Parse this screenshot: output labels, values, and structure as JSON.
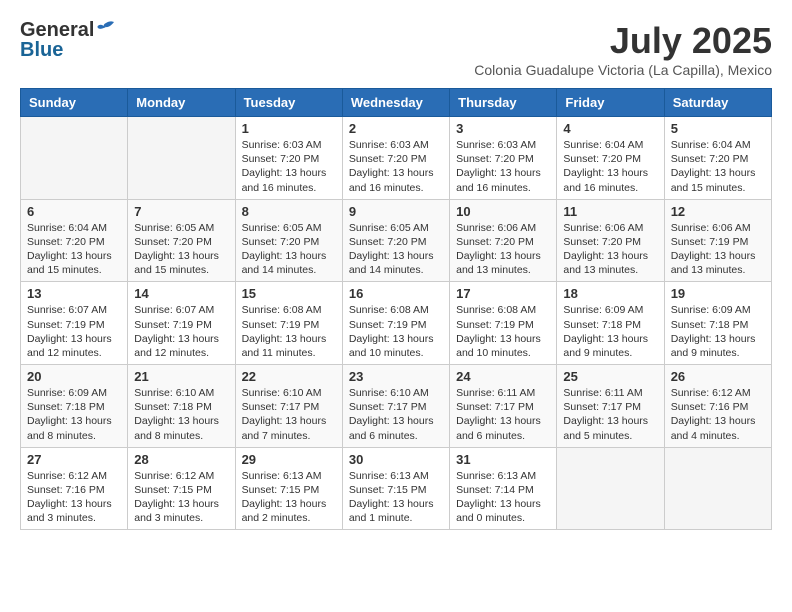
{
  "header": {
    "logo_general": "General",
    "logo_blue": "Blue",
    "month": "July 2025",
    "location": "Colonia Guadalupe Victoria (La Capilla), Mexico"
  },
  "weekdays": [
    "Sunday",
    "Monday",
    "Tuesday",
    "Wednesday",
    "Thursday",
    "Friday",
    "Saturday"
  ],
  "weeks": [
    [
      {
        "day": "",
        "info": ""
      },
      {
        "day": "",
        "info": ""
      },
      {
        "day": "1",
        "info": "Sunrise: 6:03 AM\nSunset: 7:20 PM\nDaylight: 13 hours\nand 16 minutes."
      },
      {
        "day": "2",
        "info": "Sunrise: 6:03 AM\nSunset: 7:20 PM\nDaylight: 13 hours\nand 16 minutes."
      },
      {
        "day": "3",
        "info": "Sunrise: 6:03 AM\nSunset: 7:20 PM\nDaylight: 13 hours\nand 16 minutes."
      },
      {
        "day": "4",
        "info": "Sunrise: 6:04 AM\nSunset: 7:20 PM\nDaylight: 13 hours\nand 16 minutes."
      },
      {
        "day": "5",
        "info": "Sunrise: 6:04 AM\nSunset: 7:20 PM\nDaylight: 13 hours\nand 15 minutes."
      }
    ],
    [
      {
        "day": "6",
        "info": "Sunrise: 6:04 AM\nSunset: 7:20 PM\nDaylight: 13 hours\nand 15 minutes."
      },
      {
        "day": "7",
        "info": "Sunrise: 6:05 AM\nSunset: 7:20 PM\nDaylight: 13 hours\nand 15 minutes."
      },
      {
        "day": "8",
        "info": "Sunrise: 6:05 AM\nSunset: 7:20 PM\nDaylight: 13 hours\nand 14 minutes."
      },
      {
        "day": "9",
        "info": "Sunrise: 6:05 AM\nSunset: 7:20 PM\nDaylight: 13 hours\nand 14 minutes."
      },
      {
        "day": "10",
        "info": "Sunrise: 6:06 AM\nSunset: 7:20 PM\nDaylight: 13 hours\nand 13 minutes."
      },
      {
        "day": "11",
        "info": "Sunrise: 6:06 AM\nSunset: 7:20 PM\nDaylight: 13 hours\nand 13 minutes."
      },
      {
        "day": "12",
        "info": "Sunrise: 6:06 AM\nSunset: 7:19 PM\nDaylight: 13 hours\nand 13 minutes."
      }
    ],
    [
      {
        "day": "13",
        "info": "Sunrise: 6:07 AM\nSunset: 7:19 PM\nDaylight: 13 hours\nand 12 minutes."
      },
      {
        "day": "14",
        "info": "Sunrise: 6:07 AM\nSunset: 7:19 PM\nDaylight: 13 hours\nand 12 minutes."
      },
      {
        "day": "15",
        "info": "Sunrise: 6:08 AM\nSunset: 7:19 PM\nDaylight: 13 hours\nand 11 minutes."
      },
      {
        "day": "16",
        "info": "Sunrise: 6:08 AM\nSunset: 7:19 PM\nDaylight: 13 hours\nand 10 minutes."
      },
      {
        "day": "17",
        "info": "Sunrise: 6:08 AM\nSunset: 7:19 PM\nDaylight: 13 hours\nand 10 minutes."
      },
      {
        "day": "18",
        "info": "Sunrise: 6:09 AM\nSunset: 7:18 PM\nDaylight: 13 hours\nand 9 minutes."
      },
      {
        "day": "19",
        "info": "Sunrise: 6:09 AM\nSunset: 7:18 PM\nDaylight: 13 hours\nand 9 minutes."
      }
    ],
    [
      {
        "day": "20",
        "info": "Sunrise: 6:09 AM\nSunset: 7:18 PM\nDaylight: 13 hours\nand 8 minutes."
      },
      {
        "day": "21",
        "info": "Sunrise: 6:10 AM\nSunset: 7:18 PM\nDaylight: 13 hours\nand 8 minutes."
      },
      {
        "day": "22",
        "info": "Sunrise: 6:10 AM\nSunset: 7:17 PM\nDaylight: 13 hours\nand 7 minutes."
      },
      {
        "day": "23",
        "info": "Sunrise: 6:10 AM\nSunset: 7:17 PM\nDaylight: 13 hours\nand 6 minutes."
      },
      {
        "day": "24",
        "info": "Sunrise: 6:11 AM\nSunset: 7:17 PM\nDaylight: 13 hours\nand 6 minutes."
      },
      {
        "day": "25",
        "info": "Sunrise: 6:11 AM\nSunset: 7:17 PM\nDaylight: 13 hours\nand 5 minutes."
      },
      {
        "day": "26",
        "info": "Sunrise: 6:12 AM\nSunset: 7:16 PM\nDaylight: 13 hours\nand 4 minutes."
      }
    ],
    [
      {
        "day": "27",
        "info": "Sunrise: 6:12 AM\nSunset: 7:16 PM\nDaylight: 13 hours\nand 3 minutes."
      },
      {
        "day": "28",
        "info": "Sunrise: 6:12 AM\nSunset: 7:15 PM\nDaylight: 13 hours\nand 3 minutes."
      },
      {
        "day": "29",
        "info": "Sunrise: 6:13 AM\nSunset: 7:15 PM\nDaylight: 13 hours\nand 2 minutes."
      },
      {
        "day": "30",
        "info": "Sunrise: 6:13 AM\nSunset: 7:15 PM\nDaylight: 13 hours\nand 1 minute."
      },
      {
        "day": "31",
        "info": "Sunrise: 6:13 AM\nSunset: 7:14 PM\nDaylight: 13 hours\nand 0 minutes."
      },
      {
        "day": "",
        "info": ""
      },
      {
        "day": "",
        "info": ""
      }
    ]
  ]
}
